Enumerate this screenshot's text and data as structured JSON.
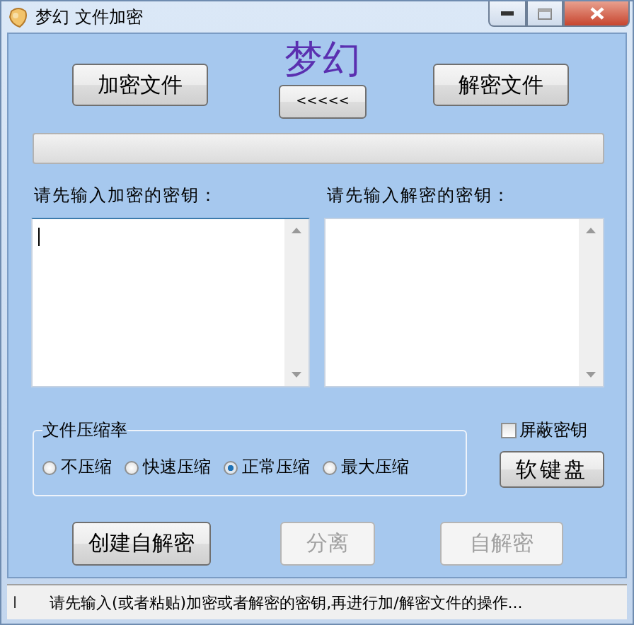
{
  "window": {
    "title": "梦幻 文件加密"
  },
  "header": {
    "logo": "梦幻",
    "encrypt_button": "加密文件",
    "swap_button": "<<<<<",
    "decrypt_button": "解密文件"
  },
  "progress": {
    "level": 0
  },
  "key_fields": [
    {
      "label": "请先输入加密的密钥：",
      "focused": true
    },
    {
      "label": "请先输入解密的密钥：",
      "focused": false
    }
  ],
  "compression": {
    "title": "文件压缩率",
    "options": [
      {
        "label": "不压缩",
        "selected": false
      },
      {
        "label": "快速压缩",
        "selected": false
      },
      {
        "label": "正常压缩",
        "selected": true
      },
      {
        "label": "最大压缩",
        "selected": false
      }
    ]
  },
  "hide_key": {
    "label": "屏蔽密钥",
    "checked": false
  },
  "keyboard_button": "软键盘",
  "actions": [
    {
      "label": "创建自解密",
      "disabled": false
    },
    {
      "label": "分离",
      "disabled": true
    },
    {
      "label": "自解密",
      "disabled": true
    }
  ],
  "status_bar": [
    "l",
    "请先输入(或者粘贴)加密或者解密的密钥,再进行加/解密文件的操作..."
  ]
}
